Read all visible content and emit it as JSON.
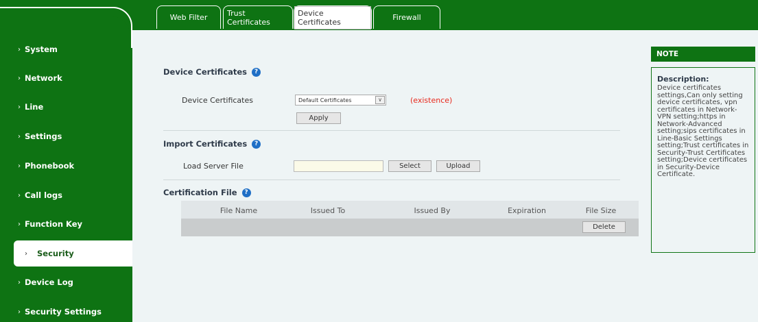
{
  "tabs": [
    {
      "label": "Web Filter",
      "selected": false
    },
    {
      "label": "Trust Certificates",
      "selected": false
    },
    {
      "label": "Device Certificates",
      "selected": true
    },
    {
      "label": "Firewall",
      "selected": false
    }
  ],
  "sidebar": {
    "items": [
      {
        "label": "System",
        "active": false
      },
      {
        "label": "Network",
        "active": false
      },
      {
        "label": "Line",
        "active": false
      },
      {
        "label": "Settings",
        "active": false
      },
      {
        "label": "Phonebook",
        "active": false
      },
      {
        "label": "Call logs",
        "active": false
      },
      {
        "label": "Function Key",
        "active": false
      },
      {
        "label": "Security",
        "active": true
      },
      {
        "label": "Device Log",
        "active": false
      },
      {
        "label": "Security Settings",
        "active": false
      }
    ]
  },
  "device_certificates": {
    "title": "Device Certificates",
    "field_label": "Device Certificates",
    "selected_value": "Default Certificates",
    "status": "(existence)",
    "apply_label": "Apply"
  },
  "import_certificates": {
    "title": "Import Certificates",
    "field_label": "Load Server File",
    "file_value": "",
    "select_label": "Select",
    "upload_label": "Upload"
  },
  "certification_file": {
    "title": "Certification File",
    "columns": [
      "File Name",
      "Issued To",
      "Issued By",
      "Expiration",
      "File Size"
    ],
    "delete_label": "Delete"
  },
  "note": {
    "header": "NOTE",
    "title": "Description:",
    "text": "Device certificates settings,Can only setting device certificates, vpn certificates in Network-VPN setting;https in Network-Advanced setting;sips certificates in Line-Basic Settings setting;Trust certificates in Security-Trust Certificates setting;Device certificates in Security-Device Certificate."
  },
  "colors": {
    "brand_green": "#0e7313",
    "status_red": "#e8281c",
    "help_blue": "#1f6fc6"
  }
}
